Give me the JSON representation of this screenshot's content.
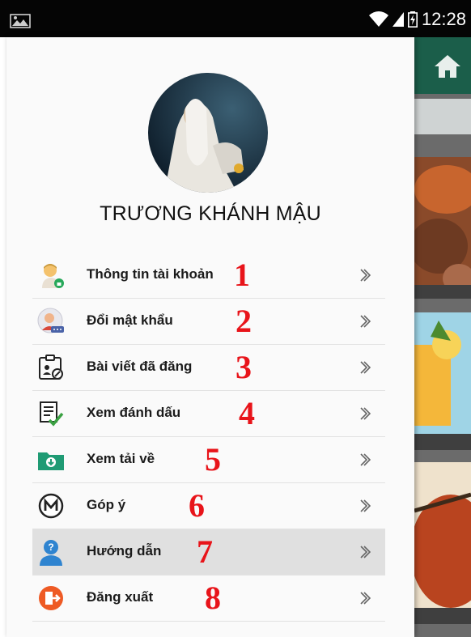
{
  "status_bar": {
    "time": "12:28"
  },
  "profile": {
    "name": "TRƯƠNG KHÁNH MẬU"
  },
  "menu": [
    {
      "label": "Thông tin tài khoản",
      "number": "1",
      "icon": "user-lock-icon"
    },
    {
      "label": "Đổi mật khẩu",
      "number": "2",
      "icon": "user-password-icon"
    },
    {
      "label": "Bài viết đã đăng",
      "number": "3",
      "icon": "posts-clipboard-icon"
    },
    {
      "label": "Xem đánh dấu",
      "number": "4",
      "icon": "checklist-icon"
    },
    {
      "label": "Xem tải về",
      "number": "5",
      "icon": "download-folder-icon"
    },
    {
      "label": "Góp ý",
      "number": "6",
      "icon": "feedback-m-icon"
    },
    {
      "label": "Hướng dẫn",
      "number": "7",
      "icon": "help-person-icon",
      "active": true
    },
    {
      "label": "Đăng xuất",
      "number": "8",
      "icon": "logout-icon"
    }
  ],
  "colors": {
    "status_bar": "#050505",
    "app_bar": "#1b5e4a",
    "annotation_red": "#e8141a",
    "active_row": "#e0e0e0"
  }
}
